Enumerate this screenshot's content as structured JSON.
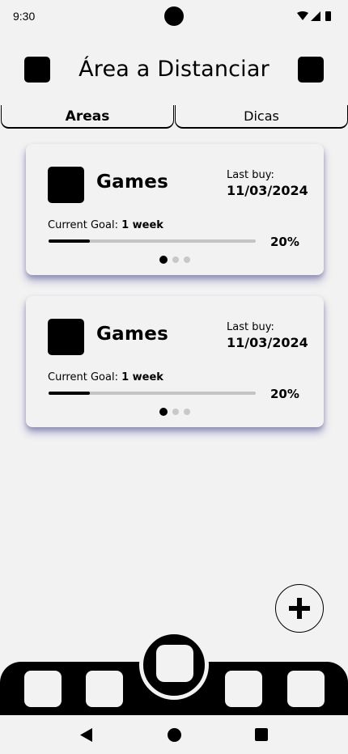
{
  "status_bar": {
    "time": "9:30",
    "icons": [
      "wifi-icon",
      "signal-icon",
      "battery-icon"
    ]
  },
  "header": {
    "title": "Área a Distanciar",
    "left_icon": "square-icon",
    "right_icon": "square-icon"
  },
  "tabs": [
    {
      "label": "Areas",
      "selected": true
    },
    {
      "label": "Dicas",
      "selected": false
    }
  ],
  "cards": [
    {
      "title": "Games",
      "last_buy_label": "Last buy:",
      "last_buy_date": "11/03/2024",
      "goal_label": "Current Goal:",
      "goal_value": "1 week",
      "progress": 0.2,
      "progress_text": "20%",
      "pager_pages": 3,
      "pager_active": 0
    },
    {
      "title": "Games",
      "last_buy_label": "Last buy:",
      "last_buy_date": "11/03/2024",
      "goal_label": "Current Goal:",
      "goal_value": "1 week",
      "progress": 0.2,
      "progress_text": "20%",
      "pager_pages": 3,
      "pager_active": 0
    }
  ],
  "fab": {
    "icon": "plus-icon"
  },
  "bottom_nav": {
    "items": [
      "nav-item-1",
      "nav-item-2",
      "nav-item-center",
      "nav-item-4",
      "nav-item-5"
    ]
  },
  "system_nav": {
    "icons": [
      "back-icon",
      "home-icon",
      "recents-icon"
    ]
  },
  "colors": {
    "background": "#f2f2f2",
    "foreground": "#000000",
    "progress_track": "#c4c4c4",
    "card_shadow": "#5050aa"
  }
}
